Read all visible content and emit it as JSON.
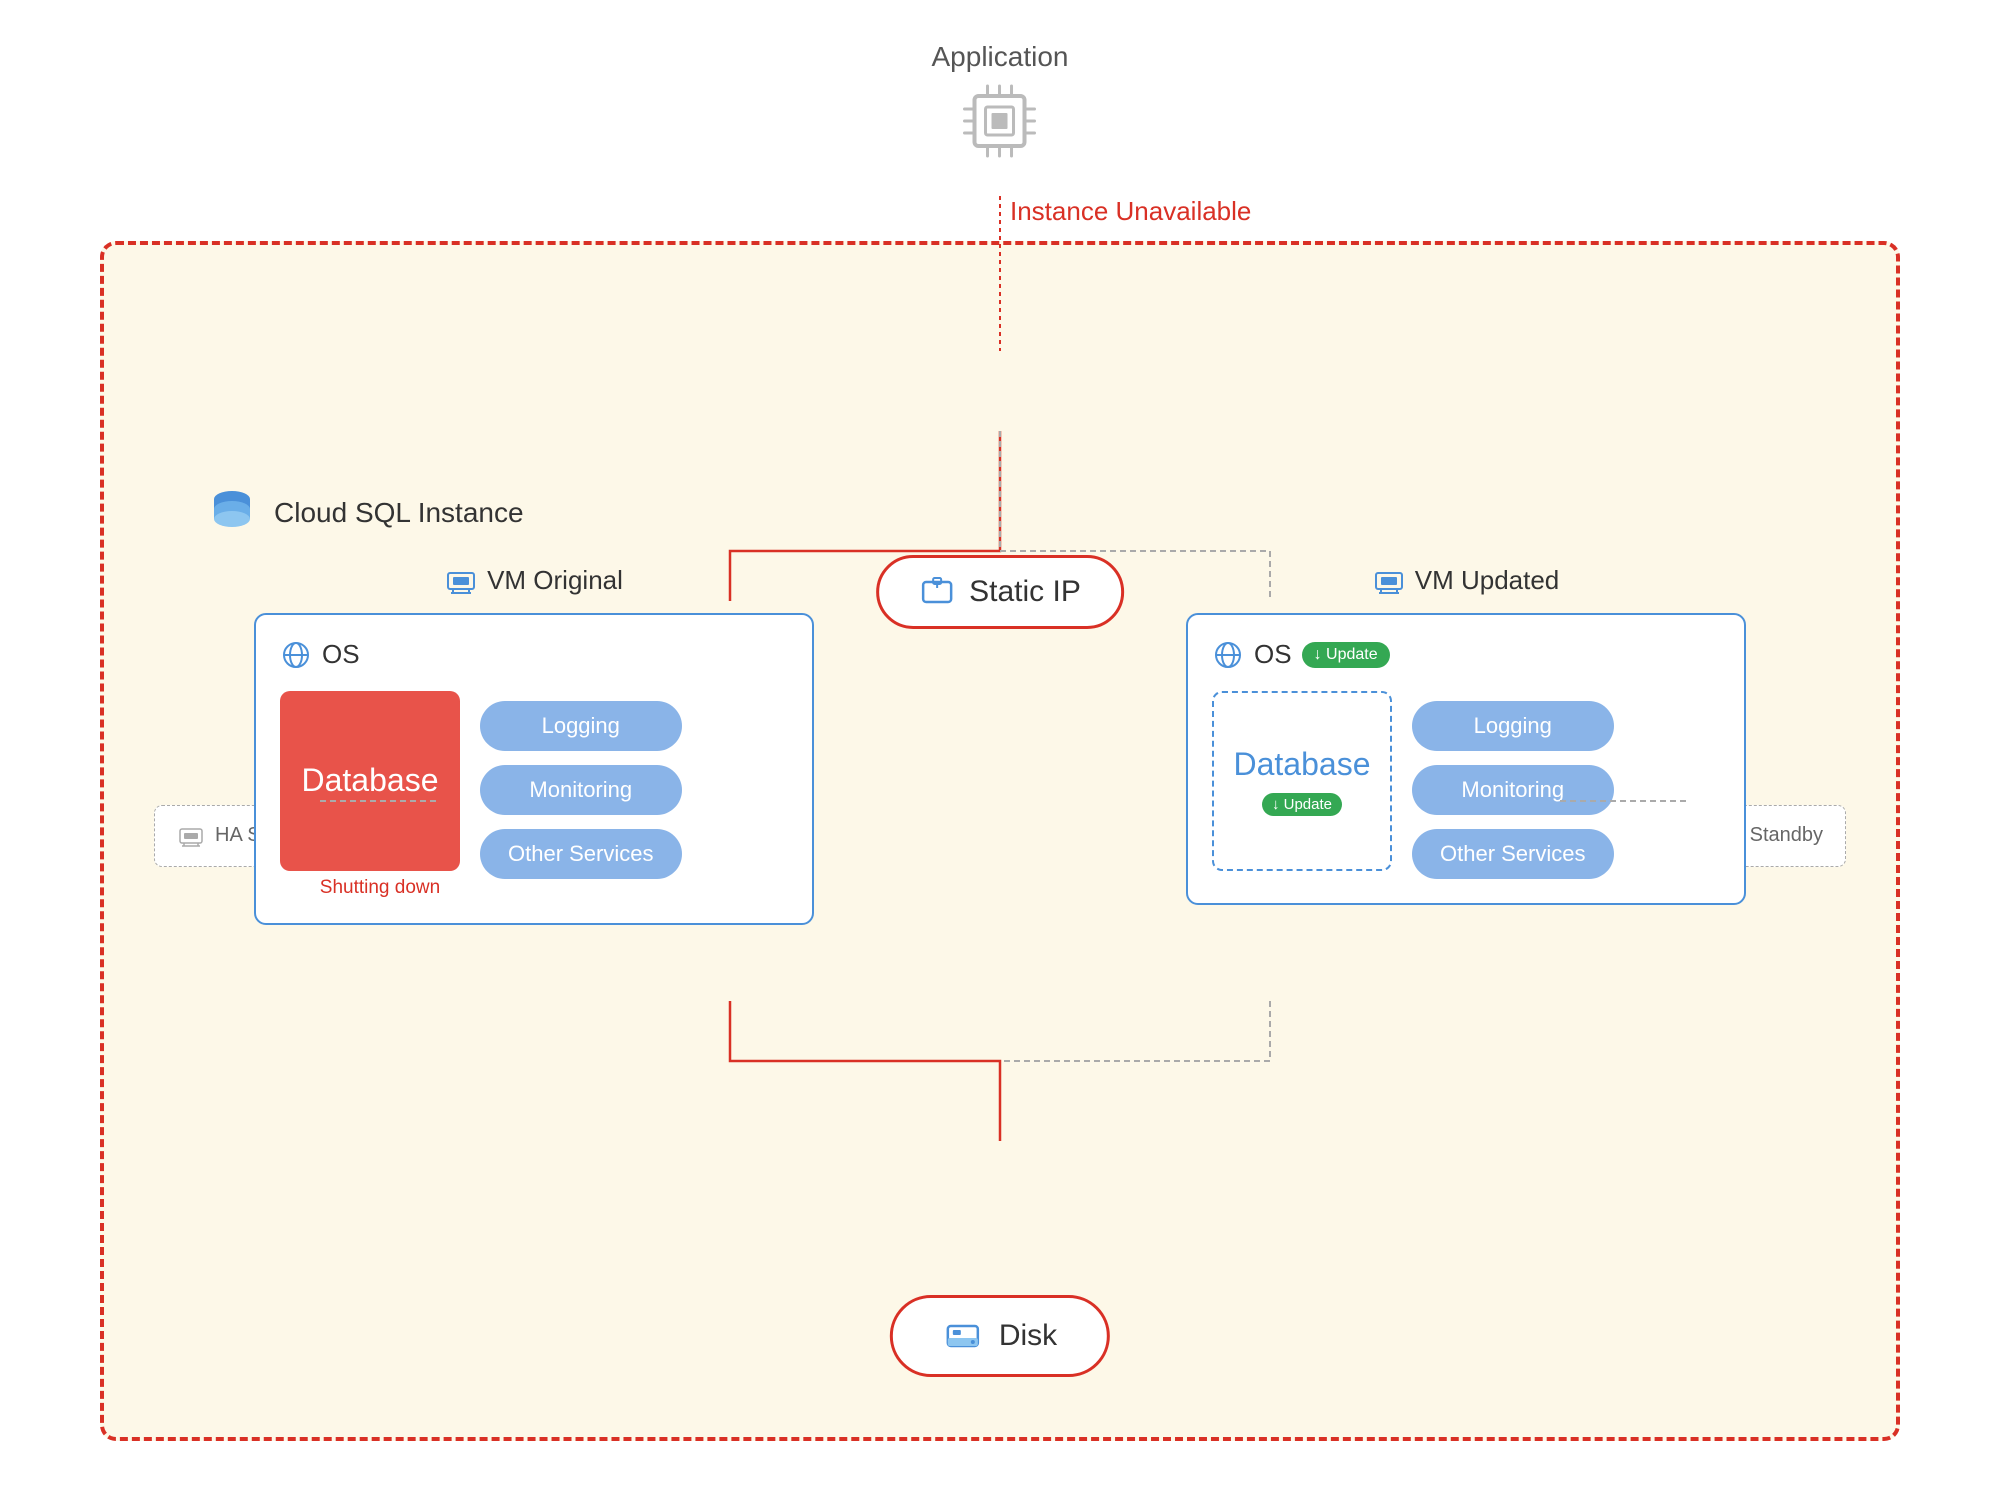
{
  "app": {
    "label": "Application"
  },
  "instance_unavailable": "Instance Unavailable",
  "cloud_sql": {
    "label": "Cloud SQL Instance"
  },
  "static_ip": {
    "label": "Static IP"
  },
  "vm_original": {
    "label": "VM Original",
    "os_label": "OS",
    "database_label": "Database",
    "shutting_down": "Shutting down",
    "services": [
      "Logging",
      "Monitoring",
      "Other Services"
    ]
  },
  "vm_updated": {
    "label": "VM Updated",
    "os_label": "OS",
    "update_badge": "↓ Update",
    "database_label": "Database",
    "db_update_badge": "↓ Update",
    "services": [
      "Logging",
      "Monitoring",
      "Other Services"
    ]
  },
  "ha_standby": {
    "label": "HA Standby"
  },
  "disk": {
    "label": "Disk"
  }
}
